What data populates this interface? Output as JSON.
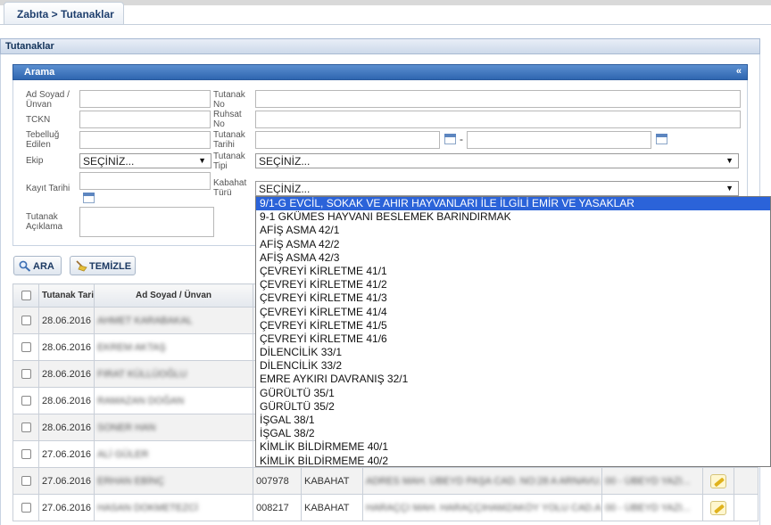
{
  "breadcrumb": {
    "root": "Zabıta",
    "sep": " > ",
    "current": "Tutanaklar"
  },
  "panel_title": "Tutanaklar",
  "search": {
    "title": "Arama",
    "collapse_glyph": "«",
    "labels": {
      "ad_soyad": "Ad Soyad / Ünvan",
      "tckn": "TCKN",
      "tebellug": "Tebelluğ Edilen",
      "ekip": "Ekip",
      "kayit_tarihi": "Kayıt Tarihi",
      "aciklama": "Tutanak Açıklama",
      "tutanak_no": "Tutanak No",
      "ruhsat_no": "Ruhsat No",
      "tutanak_tarihi": "Tutanak Tarihi",
      "tutanak_tipi": "Tutanak Tipi",
      "kabahat_turu": "Kabahat Türü"
    },
    "ekip_value": "SEÇİNİZ...",
    "tutanak_tipi_value": "SEÇİNİZ...",
    "kabahat_turu_value": "SEÇİNİZ...",
    "date_sep": "-",
    "buttons": {
      "ara": "ARA",
      "temizle": "TEMİZLE"
    }
  },
  "table": {
    "headers": [
      "Tutanak Tarihi",
      "Ad Soyad / Ünvan"
    ],
    "rows": [
      {
        "date": "28.06.2016",
        "name": "AHMET KARABAKAL"
      },
      {
        "date": "28.06.2016",
        "name": "EKREM AKTAŞ"
      },
      {
        "date": "28.06.2016",
        "name": "FIRAT KÜLLÜOĞLU"
      },
      {
        "date": "28.06.2016",
        "name": "RAMAZAN DOĞAN"
      },
      {
        "date": "28.06.2016",
        "name": "SONER HAN"
      },
      {
        "date": "27.06.2016",
        "name": "ALİ GÜLER"
      },
      {
        "date": "27.06.2016",
        "name": "ERHAN EBİNÇ",
        "no": "007978",
        "type": "KABAHAT",
        "address": "ADRES MAH. ÜBEYD PAŞA CAD. NO:28 A ARNAVU...",
        "extra": "00 - ÜBEYD YAZI..."
      },
      {
        "date": "27.06.2016",
        "name": "HASAN DOKMETEZCİ",
        "no": "008217",
        "type": "KABAHAT",
        "address": "HARAÇÇI MAH. HARAÇÇIHAMZAKÖY YOLU CAD.A...",
        "extra": "00 - ÜBEYD YAZI..."
      }
    ]
  },
  "dropdown": {
    "selected_index": 0,
    "items": [
      "9/1-G EVCİL, SOKAK VE AHIR HAYVANLARI İLE İLGİLİ EMİR VE YASAKLAR",
      "9-1 GKÜMES HAYVANI BESLEMEK BARINDIRMAK",
      "AFİŞ ASMA 42/1",
      "AFİŞ ASMA 42/2",
      "AFİŞ ASMA 42/3",
      "ÇEVREYİ KİRLETME 41/1",
      "ÇEVREYİ KİRLETME 41/2",
      "ÇEVREYİ KİRLETME 41/3",
      "ÇEVREYİ KİRLETME 41/4",
      "ÇEVREYİ KİRLETME 41/5",
      "ÇEVREYİ KİRLETME 41/6",
      "DİLENCİLİK 33/1",
      "DİLENCİLİK 33/2",
      "EMRE AYKIRI DAVRANIŞ 32/1",
      "GÜRÜLTÜ 35/1",
      "GÜRÜLTÜ 35/2",
      "İŞGAL 38/1",
      "İŞGAL 38/2",
      "KİMLİK BİLDİRMEME 40/1",
      "KİMLİK BİLDİRMEME 40/2"
    ]
  },
  "colors": {
    "accent": "#2f66b0",
    "selection": "#2b63d9",
    "breadcrumb_text": "#1f3f6e"
  }
}
